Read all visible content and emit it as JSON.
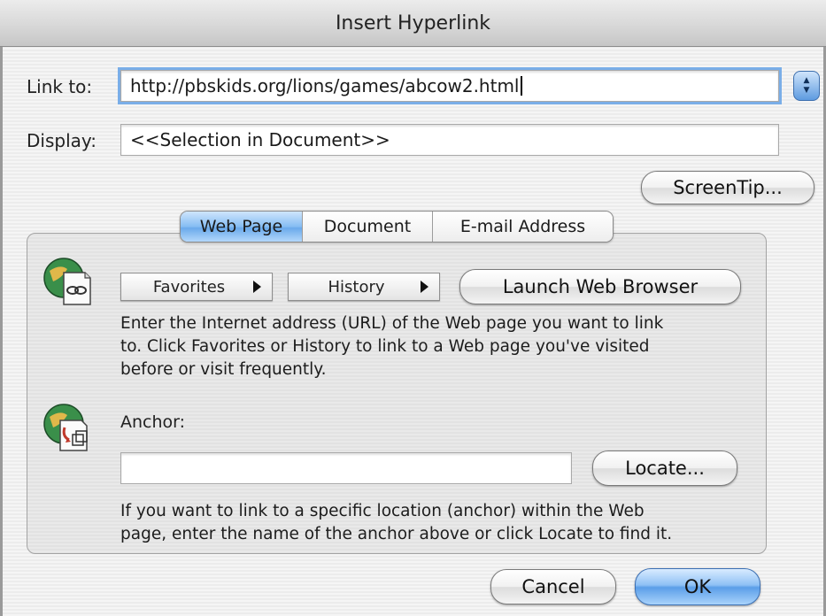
{
  "window": {
    "title": "Insert Hyperlink"
  },
  "link_to": {
    "label": "Link to:",
    "value": "http://pbskids.org/lions/games/abcow2.html"
  },
  "display": {
    "label": "Display:",
    "value": "<<Selection in Document>>"
  },
  "screentip_button": "ScreenTip...",
  "tabs": [
    {
      "label": "Web Page",
      "active": true
    },
    {
      "label": "Document",
      "active": false
    },
    {
      "label": "E-mail Address",
      "active": false
    }
  ],
  "web_page": {
    "favorites_button": "Favorites",
    "history_button": "History",
    "launch_button": "Launch Web Browser",
    "url_help_line1": "Enter the Internet address (URL) of the Web page you want to link",
    "url_help_line2": "to. Click Favorites or History to link to a Web page you've visited",
    "url_help_line3": "before or visit frequently.",
    "anchor_label": "Anchor:",
    "anchor_value": "",
    "locate_button": "Locate...",
    "anchor_help_line1": "If you want to link to a specific location (anchor) within the Web",
    "anchor_help_line2": "page, enter the name of the anchor above or click Locate to find it."
  },
  "cancel_button": "Cancel",
  "ok_button": "OK",
  "icons": {
    "web_page": "globe-link-icon",
    "anchor": "globe-anchor-icon",
    "stepper": "stepper-icon",
    "menu_arrow": "triangle-right-icon"
  }
}
